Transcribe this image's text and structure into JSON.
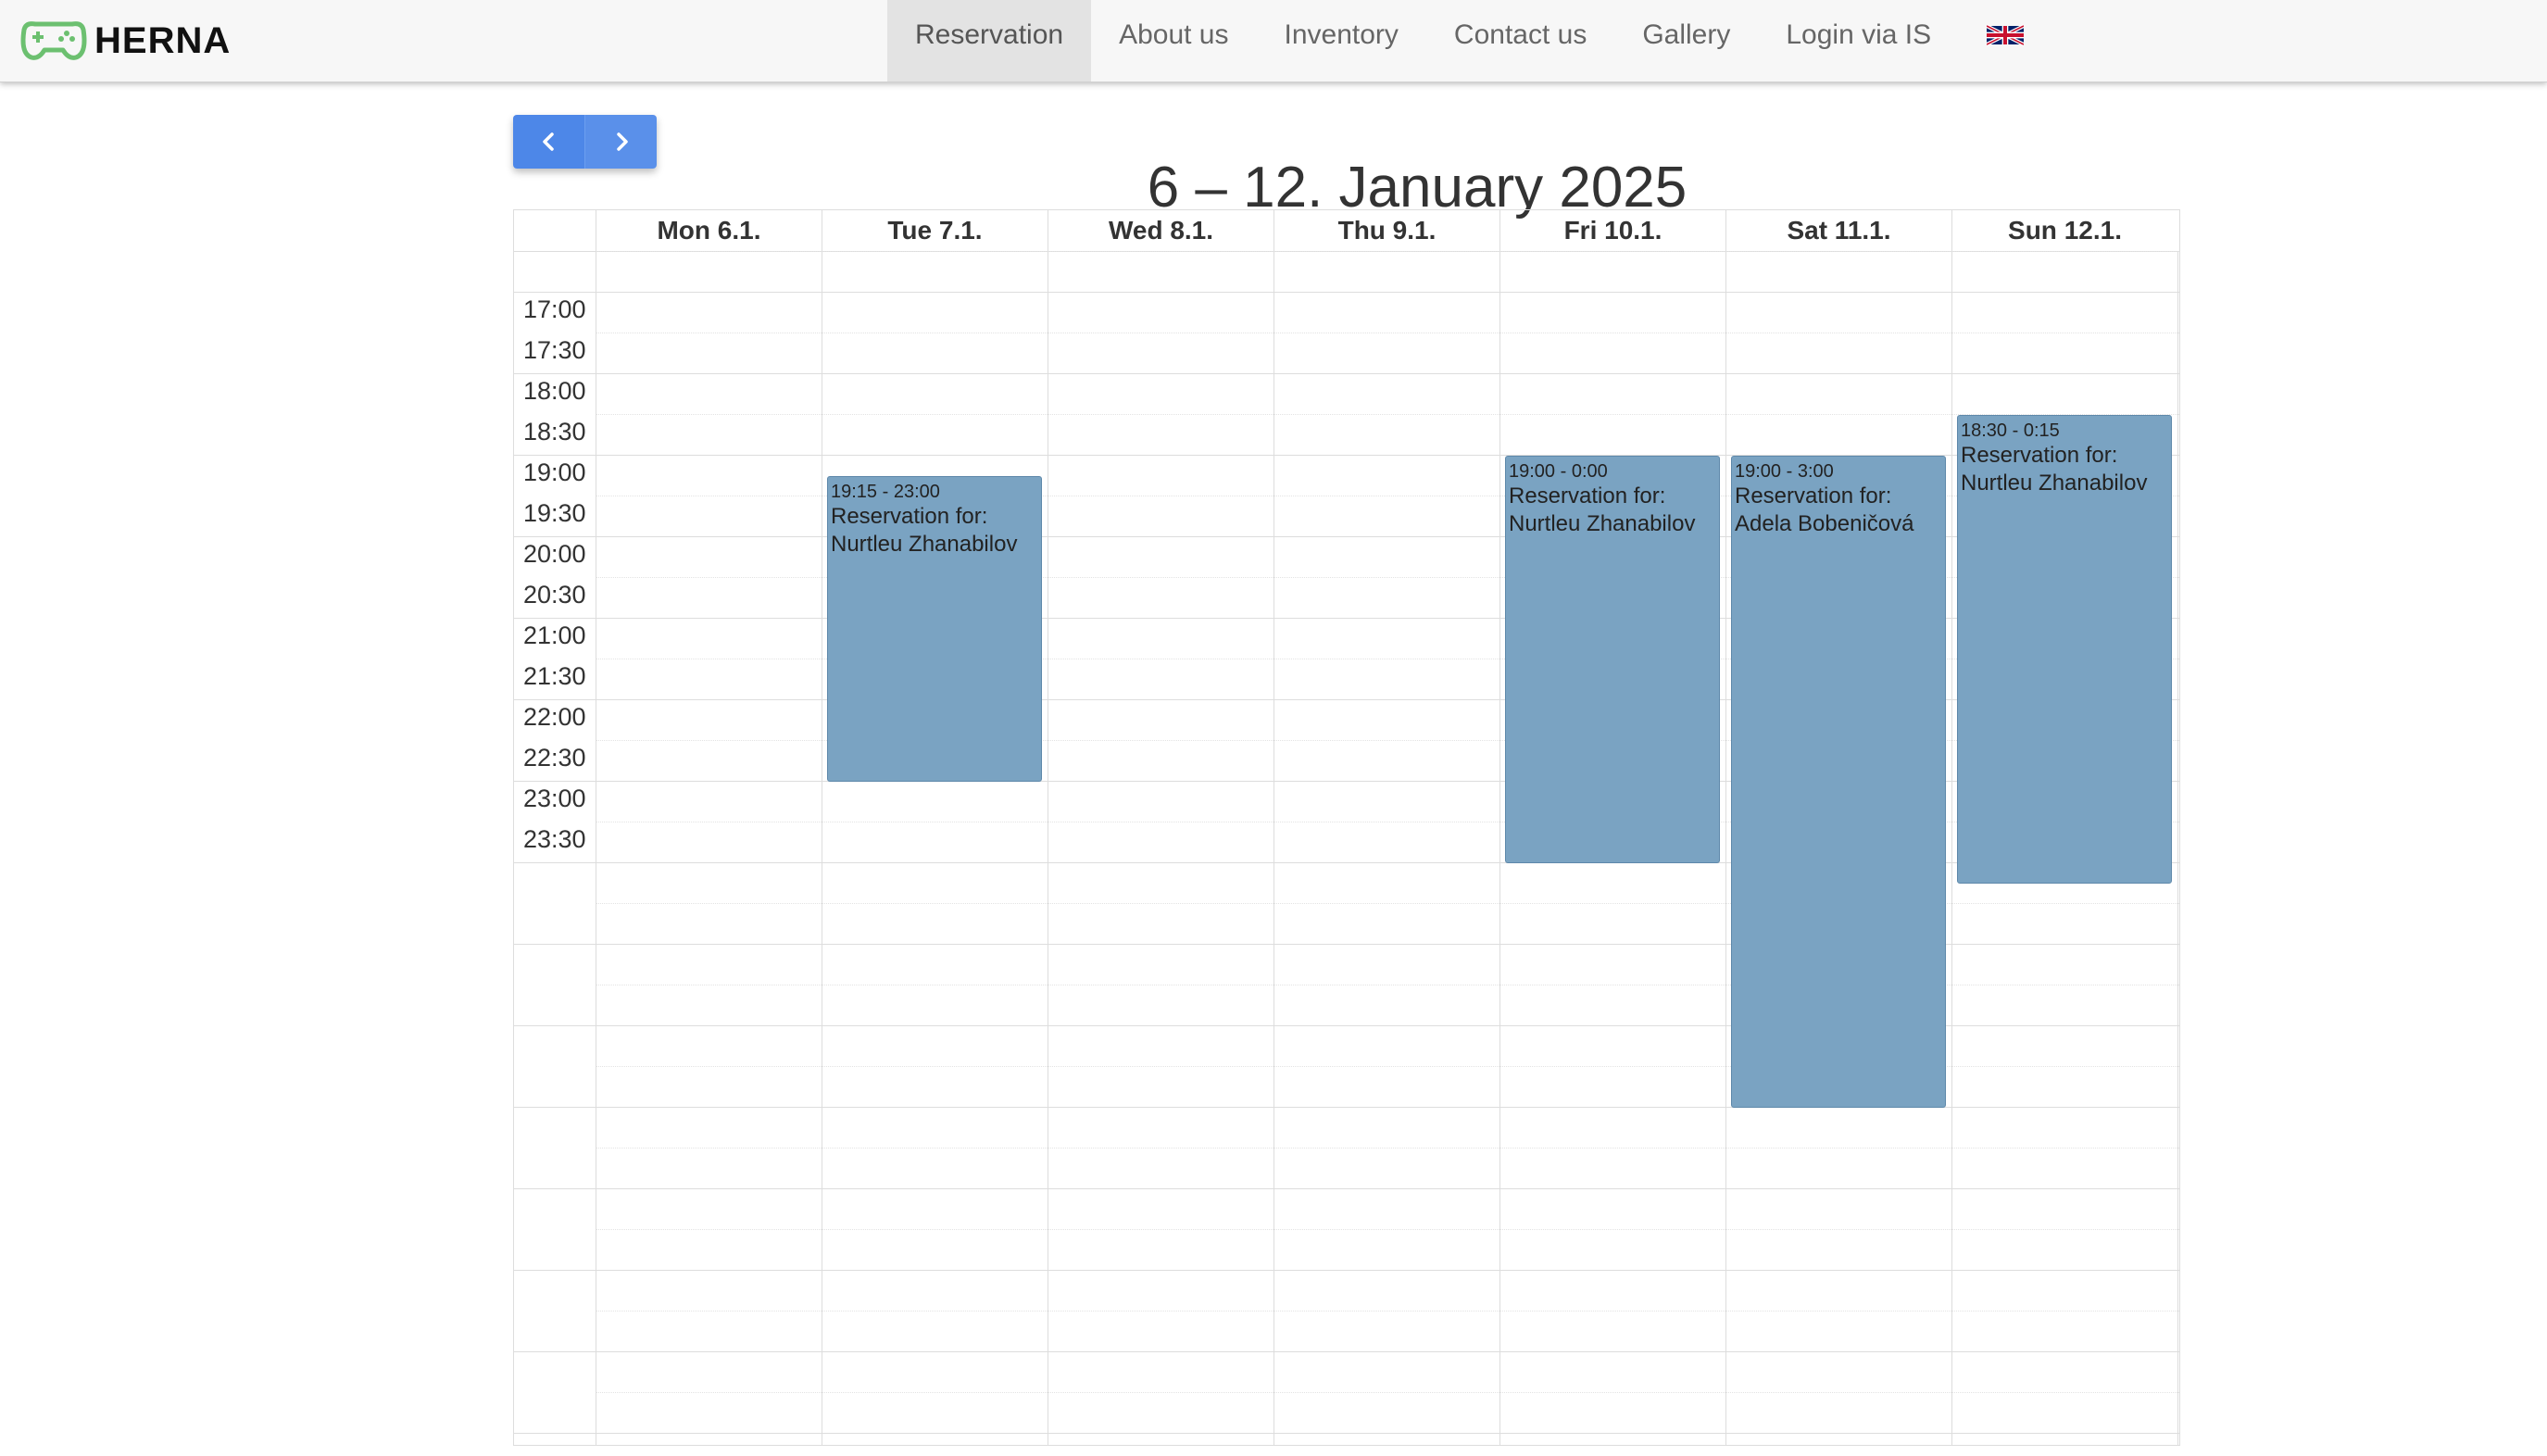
{
  "brand": {
    "name": "HERNA"
  },
  "nav": {
    "items": [
      {
        "label": "Reservation",
        "active": true
      },
      {
        "label": "About us"
      },
      {
        "label": "Inventory"
      },
      {
        "label": "Contact us"
      },
      {
        "label": "Gallery"
      },
      {
        "label": "Login via IS"
      }
    ],
    "language_icon": "uk-flag-icon"
  },
  "toolbar": {
    "prev_icon": "chevron-left-icon",
    "next_icon": "chevron-right-icon"
  },
  "calendar": {
    "title": "6 – 12. January 2025",
    "days": [
      "Mon 6.1.",
      "Tue 7.1.",
      "Wed 8.1.",
      "Thu 9.1.",
      "Fri 10.1.",
      "Sat 11.1.",
      "Sun 12.1."
    ],
    "times": [
      "17:00",
      "17:30",
      "18:00",
      "18:30",
      "19:00",
      "19:30",
      "20:00",
      "20:30",
      "21:00",
      "21:30",
      "22:00",
      "22:30",
      "23:00",
      "23:30"
    ],
    "events": [
      {
        "day": 1,
        "start": "19:15",
        "time": "19:15 - 23:00",
        "label": "Reservation for:",
        "name": "Nurtleu Zhanabilov"
      },
      {
        "day": 4,
        "start": "19:00",
        "time": "19:00 - 0:00",
        "label": "Reservation for:",
        "name": "Nurtleu Zhanabilov"
      },
      {
        "day": 5,
        "start": "19:00",
        "time": "19:00 - 3:00",
        "label": "Reservation for:",
        "name": "Adela Bobeničová"
      },
      {
        "day": 6,
        "start": "18:30",
        "time": "18:30 - 0:15",
        "label": "Reservation for:",
        "name": "Nurtleu Zhanabilov"
      }
    ]
  },
  "colors": {
    "event_bg": "#7aa3c2",
    "button_bg": "#4d87e8",
    "brand_green": "#6cc070"
  }
}
